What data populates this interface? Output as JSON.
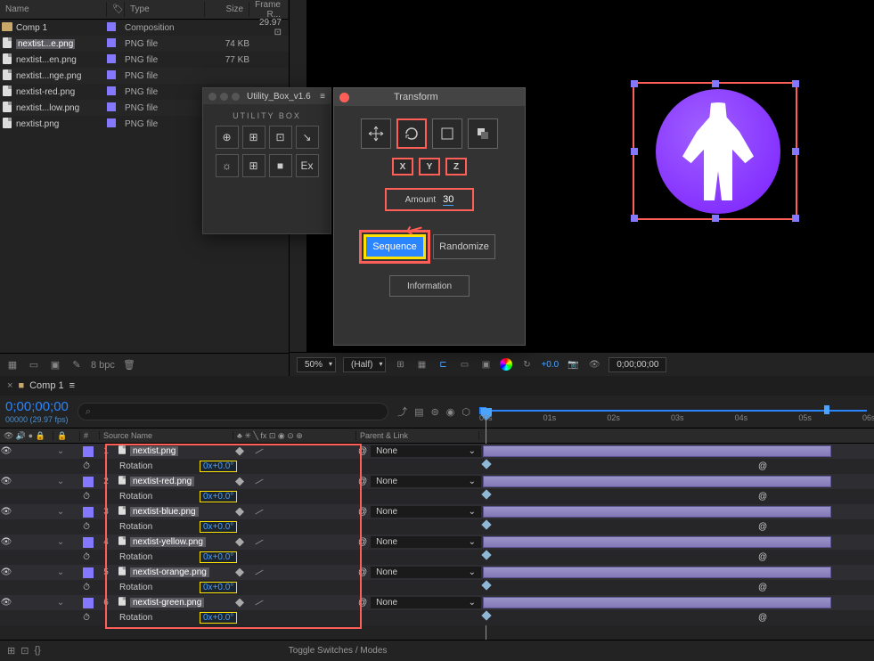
{
  "project": {
    "headers": {
      "name": "Name",
      "tag_icon": "",
      "type": "Type",
      "size": "Size",
      "frame": "Frame R..."
    },
    "rows": [
      {
        "icon": "folder",
        "name": "Comp 1",
        "type": "Composition",
        "size": "",
        "frame": "29.97",
        "tag": true,
        "sel": false
      },
      {
        "icon": "file",
        "name": "nextist...e.png",
        "type": "PNG file",
        "size": "74 KB",
        "frame": "",
        "tag": true,
        "sel": true
      },
      {
        "icon": "file",
        "name": "nextist...en.png",
        "type": "PNG file",
        "size": "77 KB",
        "frame": "",
        "tag": true,
        "sel": false
      },
      {
        "icon": "file",
        "name": "nextist...nge.png",
        "type": "PNG file",
        "size": "",
        "frame": "",
        "tag": true,
        "sel": false
      },
      {
        "icon": "file",
        "name": "nextist-red.png",
        "type": "PNG file",
        "size": "",
        "frame": "",
        "tag": true,
        "sel": false
      },
      {
        "icon": "file",
        "name": "nextist...low.png",
        "type": "PNG file",
        "size": "",
        "frame": "",
        "tag": true,
        "sel": false
      },
      {
        "icon": "file",
        "name": "nextist.png",
        "type": "PNG file",
        "size": "",
        "frame": "",
        "tag": true,
        "sel": false
      }
    ],
    "footer_bpc": "8 bpc"
  },
  "utility": {
    "title": "Utility_Box_v1.6",
    "brand": "UTILITY BOX",
    "grid1": [
      "⊕",
      "⊞",
      "⊡",
      "↘"
    ],
    "grid2": [
      "☼",
      "⊞",
      "■",
      "Ex"
    ]
  },
  "transform": {
    "title": "Transform",
    "icons": [
      "move",
      "rotate",
      "scale",
      "opacity"
    ],
    "axes": [
      "X",
      "Y",
      "Z"
    ],
    "amount_label": "Amount",
    "amount_value": "30",
    "sequence": "Sequence",
    "randomize": "Randomize",
    "information": "Information"
  },
  "preview_footer": {
    "zoom": "50%",
    "res": "(Half)",
    "exposure": "+0.0",
    "timecode": "0;00;00;00"
  },
  "timeline": {
    "tab": "Comp 1",
    "timecode": "0;00;00;00",
    "fps": "00000 (29.97 fps)",
    "search_placeholder": "",
    "ticks": [
      "00s",
      "01s",
      "02s",
      "03s",
      "04s",
      "05s",
      "06s"
    ],
    "cols": {
      "num": "#",
      "src": "Source Name",
      "sw": "",
      "par": "Parent & Link"
    },
    "switches_icons": "♣ ✳ ╲ fx ⊡ ◉ ⊙ ⊕",
    "layers": [
      {
        "n": "1",
        "name": "nextist.png",
        "prop": "Rotation",
        "val": "0x+0.0°",
        "parent": "None"
      },
      {
        "n": "2",
        "name": "nextist-red.png",
        "prop": "Rotation",
        "val": "0x+0.0°",
        "parent": "None"
      },
      {
        "n": "3",
        "name": "nextist-blue.png",
        "prop": "Rotation",
        "val": "0x+0.0°",
        "parent": "None"
      },
      {
        "n": "4",
        "name": "nextist-yellow.png",
        "prop": "Rotation",
        "val": "0x+0.0°",
        "parent": "None"
      },
      {
        "n": "5",
        "name": "nextist-orange.png",
        "prop": "Rotation",
        "val": "0x+0.0°",
        "parent": "None"
      },
      {
        "n": "6",
        "name": "nextist-green.png",
        "prop": "Rotation",
        "val": "0x+0.0°",
        "parent": "None"
      }
    ],
    "toggle": "Toggle Switches / Modes"
  }
}
